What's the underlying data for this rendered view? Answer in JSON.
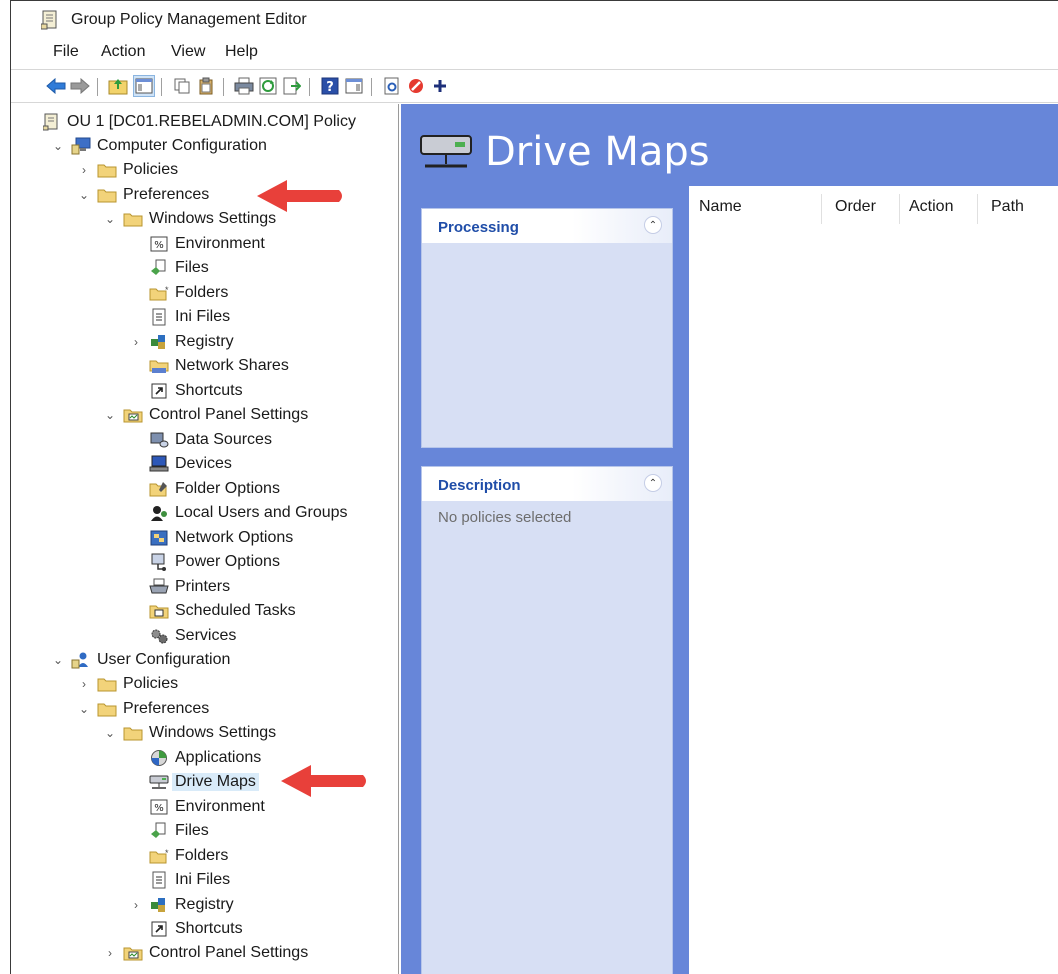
{
  "window": {
    "title": "Group Policy Management Editor"
  },
  "menu": [
    "File",
    "Action",
    "View",
    "Help"
  ],
  "toolbar_icons": [
    "back-icon",
    "forward-icon",
    "up-folder-icon",
    "show-hide-tree-icon",
    "copy-icon",
    "paste-icon",
    "print-icon",
    "refresh-icon",
    "export-list-icon",
    "help-icon",
    "show-action-pane-icon",
    "properties-icon",
    "stop-icon",
    "add-icon"
  ],
  "tree": {
    "root": "OU 1 [DC01.REBELADMIN.COM] Policy",
    "computer_config": "Computer Configuration",
    "cc_policies": "Policies",
    "cc_preferences": "Preferences",
    "cc_windows_settings": "Windows Settings",
    "cc_ws_items": [
      "Environment",
      "Files",
      "Folders",
      "Ini Files",
      "Registry",
      "Network Shares",
      "Shortcuts"
    ],
    "cc_control_panel": "Control Panel Settings",
    "cc_cp_items": [
      "Data Sources",
      "Devices",
      "Folder Options",
      "Local Users and Groups",
      "Network Options",
      "Power Options",
      "Printers",
      "Scheduled Tasks",
      "Services"
    ],
    "user_config": "User Configuration",
    "uc_policies": "Policies",
    "uc_preferences": "Preferences",
    "uc_windows_settings": "Windows Settings",
    "uc_ws_items": [
      "Applications",
      "Drive Maps",
      "Environment",
      "Files",
      "Folders",
      "Ini Files",
      "Registry",
      "Shortcuts"
    ],
    "uc_control_panel": "Control Panel Settings",
    "selected": "Drive Maps"
  },
  "main": {
    "title": "Drive Maps",
    "processing_title": "Processing",
    "description_title": "Description",
    "description_text": "No policies selected",
    "columns": [
      "Name",
      "Order",
      "Action",
      "Path"
    ]
  },
  "colors": {
    "banner": "#6786d9",
    "panel": "#d7dff4",
    "panel_title": "#1f4da8",
    "arrow": "#e8403a",
    "selection": "#d9ebf9"
  }
}
